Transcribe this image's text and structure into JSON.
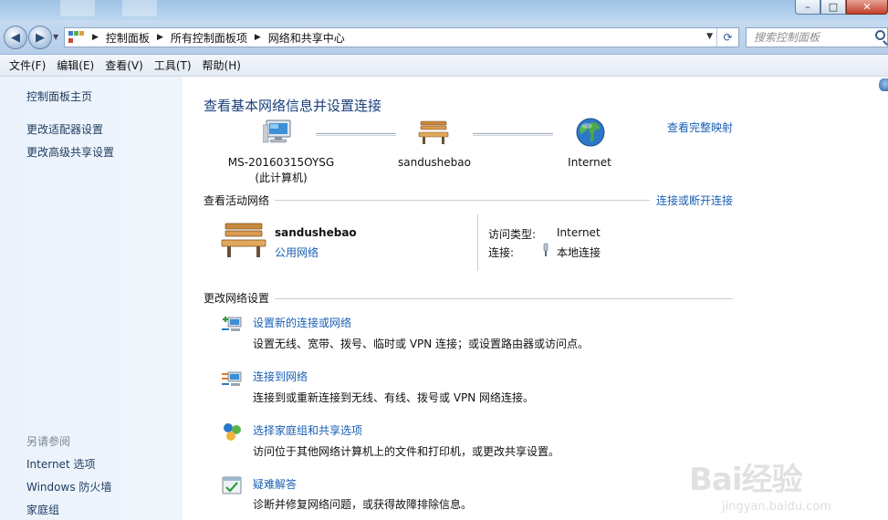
{
  "window": {
    "controls": [
      "minimize-icon",
      "maximize-icon",
      "close-icon"
    ]
  },
  "address_bar": {
    "breadcrumbs": [
      "控制面板",
      "所有控制面板项",
      "网络和共享中心"
    ],
    "search_placeholder": "搜索控制面板"
  },
  "menu": [
    "文件(F)",
    "编辑(E)",
    "查看(V)",
    "工具(T)",
    "帮助(H)"
  ],
  "sidebar": {
    "links": [
      "控制面板主页",
      "更改适配器设置",
      "更改高级共享设置"
    ],
    "see_also_heading": "另请参阅",
    "see_also": [
      "Internet 选项",
      "Windows 防火墙",
      "家庭组"
    ]
  },
  "main": {
    "title": "查看基本网络信息并设置连接",
    "full_map_link": "查看完整映射",
    "map": {
      "computer_name": "MS-20160315OYSG",
      "computer_sub": "(此计算机)",
      "network_name": "sandushebao",
      "internet_label": "Internet"
    },
    "active_networks": {
      "heading": "查看活动网络",
      "connect_link": "连接或断开连接",
      "network_name": "sandushebao",
      "network_type": "公用网络",
      "access_type_label": "访问类型:",
      "access_type_value": "Internet",
      "connection_label": "连接:",
      "connection_value": "本地连接"
    },
    "change_settings": {
      "heading": "更改网络设置",
      "tasks": [
        {
          "title": "设置新的连接或网络",
          "desc": "设置无线、宽带、拨号、临时或 VPN 连接；或设置路由器或访问点。",
          "icon": "new-connection-icon"
        },
        {
          "title": "连接到网络",
          "desc": "连接到或重新连接到无线、有线、拨号或 VPN 网络连接。",
          "icon": "connect-network-icon"
        },
        {
          "title": "选择家庭组和共享选项",
          "desc": "访问位于其他网络计算机上的文件和打印机，或更改共享设置。",
          "icon": "homegroup-icon"
        },
        {
          "title": "疑难解答",
          "desc": "诊断并修复网络问题，或获得故障排除信息。",
          "icon": "troubleshoot-icon"
        }
      ]
    }
  },
  "watermark": {
    "logo": "Bai经验",
    "url": "jingyan.baidu.com"
  },
  "colors": {
    "link": "#1a5fb4",
    "title": "#1a3f7a",
    "sidebar_bg": "#eaf2fb",
    "titlebar": "#9fc2e6"
  }
}
